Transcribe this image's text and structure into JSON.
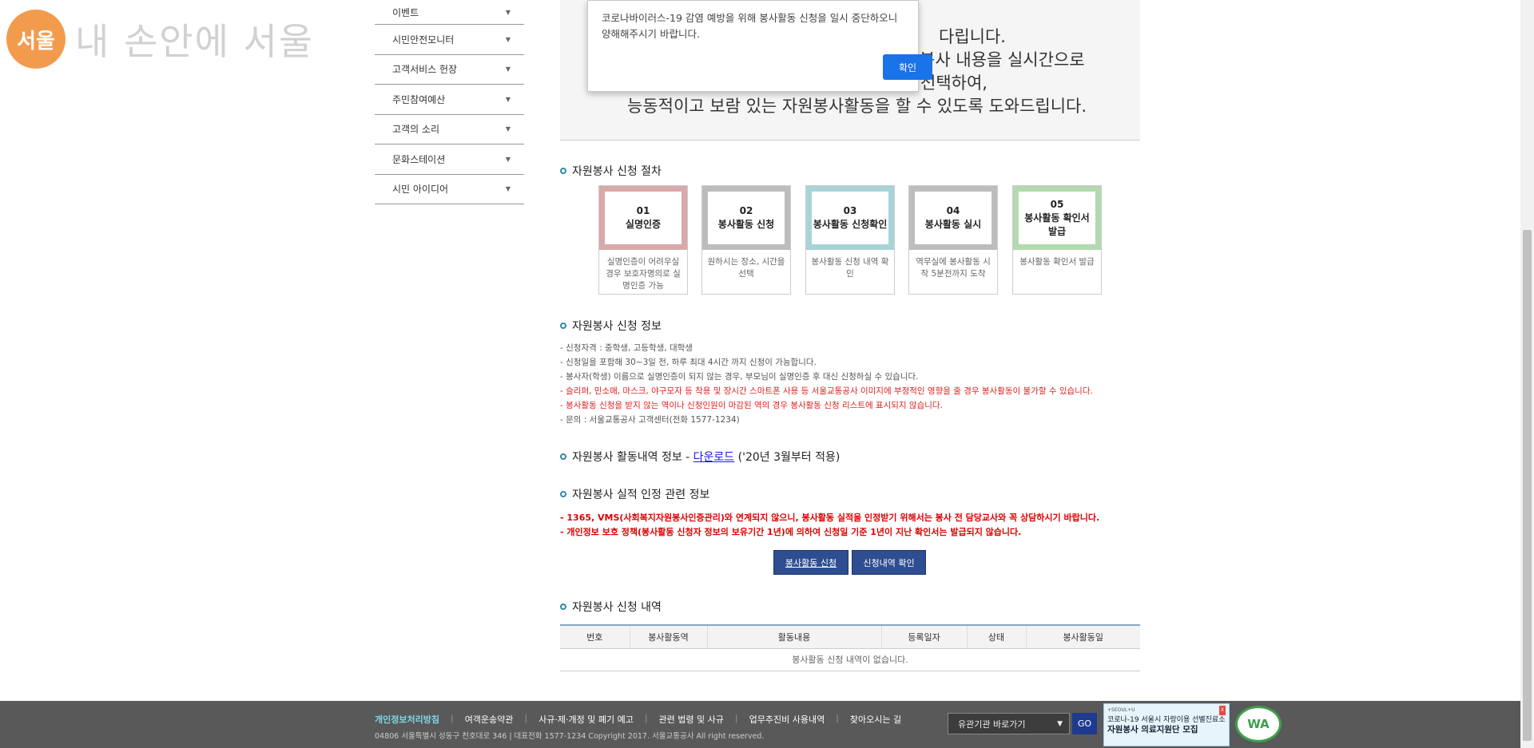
{
  "logo": {
    "mark": "서울",
    "text": "내 손안에 서울"
  },
  "sidebar": {
    "items": [
      {
        "label": "이벤트"
      },
      {
        "label": "시민안전모니터"
      },
      {
        "label": "고객서비스 헌장"
      },
      {
        "label": "주민참여예산"
      },
      {
        "label": "고객의 소리"
      },
      {
        "label": "문화스테이션"
      },
      {
        "label": "시민 아이디어"
      }
    ],
    "arrow": "▼"
  },
  "intro": {
    "line1": "다립니다.",
    "line2": "봉사 내용을 실시간으로",
    "line3": "선택하여,",
    "line4": "능동적이고 보람 있는 자원봉사활동을 할 수 있도록 도와드립니다."
  },
  "procedure": {
    "title": "자원봉사 신청 절차",
    "steps": [
      {
        "num": "01",
        "name": "실명인증",
        "desc": "실명인증이 어려우실 경우 보호자명의로 실명인증 가능",
        "color": "#d9a8a8"
      },
      {
        "num": "02",
        "name": "봉사활동 신청",
        "desc": "원하시는 장소, 시간을 선택",
        "color": "#bdbdbd"
      },
      {
        "num": "03",
        "name": "봉사활동 신청확인",
        "desc": "봉사활동 신청 내역 확인",
        "color": "#a8d4d8"
      },
      {
        "num": "04",
        "name": "봉사활동 실시",
        "desc": "역무실에 봉사활동 시작 5분전까지 도착",
        "color": "#bdbdbd"
      },
      {
        "num": "05",
        "name": "봉사활동 확인서 발급",
        "desc": "봉사활동 확인서 발급",
        "color": "#b3d9b0"
      }
    ]
  },
  "info": {
    "title": "자원봉사 신청 정보",
    "lines": [
      "- 신청자격 : 중학생, 고등학생, 대학생",
      "- 신청일을 포함해 30~3일 전, 하루 최대 4시간 까지 신청이 가능합니다.",
      "- 봉사자(학생) 이름으로 실명인증이 되지 않는 경우, 부모님이 실명인증 후 대신 신청하실 수 있습니다.",
      "- 슬리퍼, 민소매, 마스크, 야구모자 등 착용 및 장시간 스마트폰 사용 등 서울교통공사 이미지에 부정적인 영향을 줄 경우 봉사활동이 불가할 수 있습니다.",
      "- 봉사활동 신청을 받지 않는 역이나 신청인원이 마감된 역의 경우 봉사활동 신청 리스트에 표시되지 않습니다.",
      "- 문의 : 서울교통공사 고객센터(전화 1577-1234)"
    ]
  },
  "history": {
    "title_prefix": "자원봉사 활동내역 정보 - ",
    "link": "다운로드",
    "title_suffix": " ('20년 3월부터 적용)"
  },
  "record": {
    "title": "자원봉사 실적 인정 관련 정보",
    "line1": "- 1365, VMS(사회복지자원봉사인증관리)와 연계되지 않으니, 봉사활동 실적을 인정받기 위해서는 봉사 전 담당교사와 꼭 상담하시기 바랍니다.",
    "line2": "- 개인정보 보호 정책(봉사활동 신청자 정보의 보유기간 1년)에 의하여 신청일 기준 1년이 지난 확인서는 발급되지 않습니다."
  },
  "buttons": {
    "apply": "봉사활동 신청",
    "check": "신청내역 확인"
  },
  "list": {
    "title": "자원봉사 신청 내역",
    "headers": [
      "번호",
      "봉사활동역",
      "활동내용",
      "등록일자",
      "상태",
      "봉사활동일"
    ],
    "empty": "봉사활동 신청 내역이 없습니다."
  },
  "footer": {
    "links": [
      "개인정보처리방침",
      "여객운송약관",
      "사규·제·개정 및 폐기 예고",
      "관련 법령 및 사규",
      "업무추진비 사용내역",
      "찾아오시는 길"
    ],
    "address": "04806 서울특별시 성동구 천호대로 346 | 대표전화 1577-1234 Copyright 2017. 서울교통공사 All right reserved.",
    "select_label": "유관기관 바로가기",
    "go": "GO",
    "banner_tag": "+SEOUL+U",
    "banner_close": "X",
    "banner_line1": "코로나-19 서울시 자랑이용 선별진료소",
    "banner_line2": "자원봉사 의료지원단 모집",
    "wa_mark": "WA"
  },
  "alert": {
    "message": "코로나바이러스-19 감염 예방을 위해 봉사활동 신청을 일시 중단하오니 양해해주시기 바랍니다.",
    "ok": "확인"
  }
}
